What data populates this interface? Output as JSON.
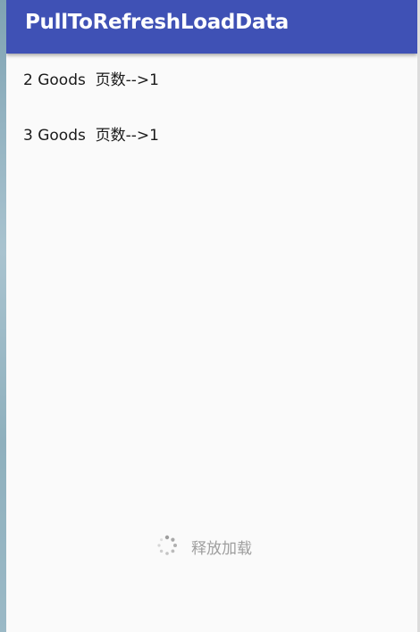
{
  "app_bar": {
    "title": "PullToRefreshLoadData"
  },
  "list": {
    "items": [
      {
        "label": "2 Goods  页数-->1"
      },
      {
        "label": "3 Goods  页数-->1"
      }
    ]
  },
  "footer": {
    "label": "释放加载",
    "icon": "loading-spinner-icon"
  },
  "colors": {
    "app_bar": "#3f51b5",
    "background": "#fafafa",
    "footer_text": "#9e9e9e"
  }
}
